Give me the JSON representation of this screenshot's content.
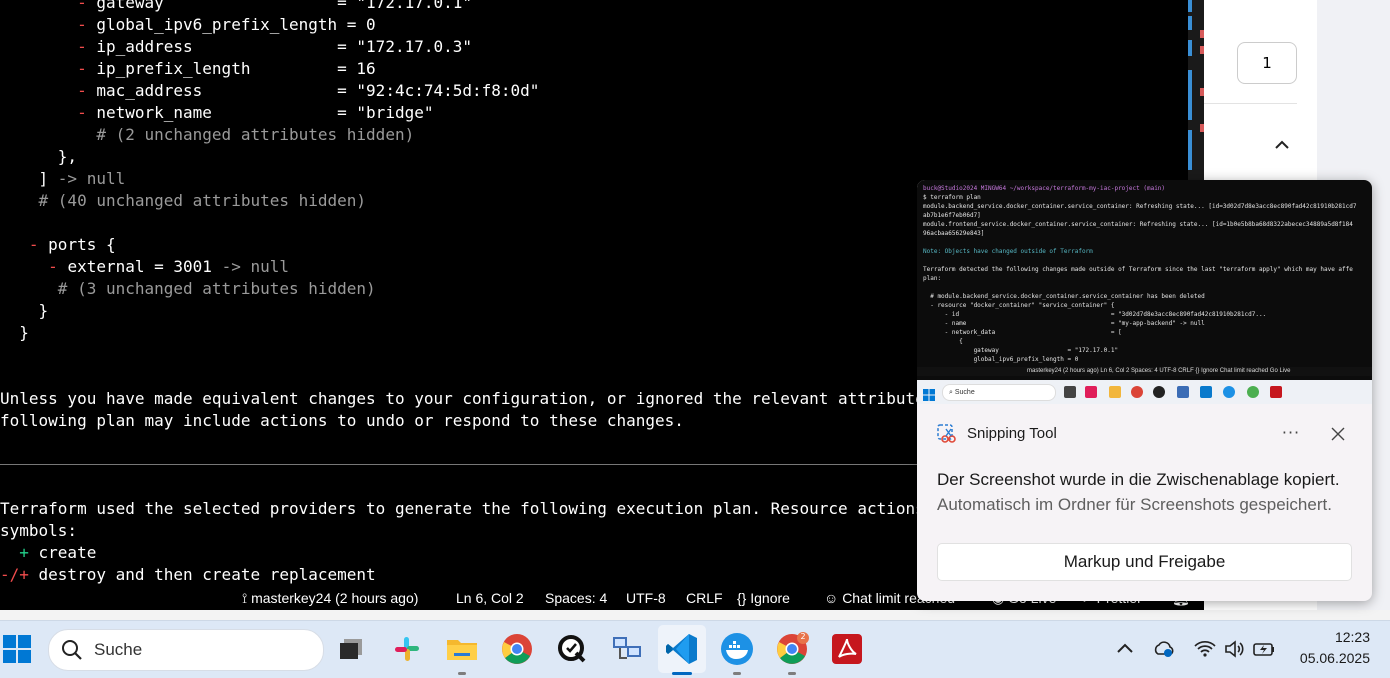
{
  "terminal": {
    "lines": [
      {
        "indent": "        ",
        "prefix": "- ",
        "text": "gateway                  = \"172.17.0.1\"",
        "suffix": ""
      },
      {
        "indent": "        ",
        "prefix": "- ",
        "text": "global_ipv6_prefix_length = 0",
        "suffix": ""
      },
      {
        "indent": "        ",
        "prefix": "- ",
        "text": "ip_address               = \"172.17.0.3\"",
        "suffix": ""
      },
      {
        "indent": "        ",
        "prefix": "- ",
        "text": "ip_prefix_length         = 16",
        "suffix": ""
      },
      {
        "indent": "        ",
        "prefix": "- ",
        "text": "mac_address              = \"92:4c:74:5d:f8:0d\"",
        "suffix": ""
      },
      {
        "indent": "        ",
        "prefix": "- ",
        "text": "network_name             = \"bridge\"",
        "suffix": ""
      },
      {
        "indent": "          ",
        "prefix": "",
        "text": "",
        "suffix": "# (2 unchanged attributes hidden)"
      },
      {
        "indent": "      ",
        "prefix": "",
        "text": "},",
        "suffix": ""
      },
      {
        "indent": "    ",
        "prefix": "",
        "text": "] ",
        "suffix": "-> null"
      },
      {
        "indent": "    ",
        "prefix": "",
        "text": "",
        "suffix": "# (40 unchanged attributes hidden)"
      },
      {
        "indent": "",
        "prefix": "",
        "text": "",
        "suffix": ""
      },
      {
        "indent": "   ",
        "prefix": "- ",
        "text": "ports {",
        "suffix": ""
      },
      {
        "indent": "     ",
        "prefix": "- ",
        "text": "external = 3001 ",
        "suffix": "-> null"
      },
      {
        "indent": "      ",
        "prefix": "",
        "text": "",
        "suffix": "# (3 unchanged attributes hidden)"
      },
      {
        "indent": "    ",
        "prefix": "",
        "text": "}",
        "suffix": ""
      },
      {
        "indent": "  ",
        "prefix": "",
        "text": "}",
        "suffix": ""
      },
      {
        "indent": "",
        "prefix": "",
        "text": "",
        "suffix": ""
      },
      {
        "indent": "",
        "prefix": "",
        "text": "",
        "suffix": ""
      },
      {
        "indent": "",
        "prefix": "",
        "text": "Unless you have made equivalent changes to your configuration, or ignored the relevant attributes usin",
        "suffix": ""
      },
      {
        "indent": "",
        "prefix": "",
        "text": "following plan may include actions to undo or respond to these changes.",
        "suffix": ""
      },
      {
        "indent": "",
        "prefix": "",
        "text": "",
        "suffix": ""
      },
      {
        "indent": "",
        "prefix": "",
        "text": "",
        "suffix": ""
      },
      {
        "indent": "",
        "prefix": "",
        "text": "",
        "suffix": ""
      },
      {
        "indent": "",
        "prefix": "",
        "text": "Terraform used the selected providers to generate the following execution plan. Resource actions are i",
        "suffix": ""
      },
      {
        "indent": "",
        "prefix": "",
        "text": "symbols:",
        "suffix": ""
      },
      {
        "indent": "  ",
        "prefix": "+ ",
        "text": "create",
        "suffix": "",
        "prefixColor": "green"
      },
      {
        "indent": "",
        "prefix": "-/+ ",
        "text": "destroy and then create replacement",
        "suffix": "",
        "prefixColor": "mixed"
      }
    ]
  },
  "right_panel": {
    "page_number": "1"
  },
  "statusbar": {
    "branch": "masterkey24 (2 hours ago)",
    "position": "Ln 6, Col 2",
    "spaces": "Spaces: 4",
    "encoding": "UTF-8",
    "eol": "CRLF",
    "language": "Ignore",
    "chat": "Chat limit reached",
    "golive": "Go Live",
    "prettier": "Prettier"
  },
  "snipping": {
    "app_name": "Snipping Tool",
    "more": "···",
    "message": "Der Screenshot wurde in die Zwischenablage kopiert.",
    "submessage": "Automatisch im Ordner für Screenshots gespeichert.",
    "button": "Markup und Freigabe",
    "preview": {
      "lines": [
        {
          "cls": "p",
          "text": "buck@Studio2024 MINGW64 ~/workspace/terraform-my-iac-project (main)"
        },
        {
          "cls": "",
          "text": "$ terraform plan"
        },
        {
          "cls": "",
          "text": "module.backend_service.docker_container.service_container: Refreshing state... [id=3d02d7d8e3acc8ec890fad42c81910b281cd7"
        },
        {
          "cls": "",
          "text": "ab7b1e6f7eb06d7]"
        },
        {
          "cls": "",
          "text": "module.frontend_service.docker_container.service_container: Refreshing state... [id=1b0e5b8ba68d8322abecec34889a5d8f184"
        },
        {
          "cls": "",
          "text": "96acbaa65629e843]"
        },
        {
          "cls": "",
          "text": ""
        },
        {
          "cls": "c",
          "text": "Note: Objects have changed outside of Terraform"
        },
        {
          "cls": "",
          "text": ""
        },
        {
          "cls": "",
          "text": "Terraform detected the following changes made outside of Terraform since the last \"terraform apply\" which may have affe"
        },
        {
          "cls": "",
          "text": "plan:"
        },
        {
          "cls": "",
          "text": ""
        },
        {
          "cls": "",
          "text": "  # module.backend_service.docker_container.service_container has been deleted"
        },
        {
          "cls": "",
          "text": "  - resource \"docker_container\" \"service_container\" {"
        },
        {
          "cls": "",
          "text": "      - id                                          = \"3d02d7d8e3acc8ec890fad42c81910b281cd7..."
        },
        {
          "cls": "",
          "text": "      - name                                        = \"my-app-backend\" -> null"
        },
        {
          "cls": "",
          "text": "      - network_data                                = ["
        },
        {
          "cls": "",
          "text": "          {"
        },
        {
          "cls": "",
          "text": "              gateway                   = \"172.17.0.1\""
        },
        {
          "cls": "",
          "text": "              global_ipv6_prefix_length = 0"
        }
      ],
      "status": "masterkey24 (2 hours ago)   Ln 6, Col 2   Spaces: 4   UTF-8   CRLF   {} Ignore   Chat limit reached   Go Live",
      "search": "Suche"
    }
  },
  "taskbar": {
    "search_placeholder": "Suche",
    "time": "12:23",
    "date": "05.06.2025",
    "notification_count": "2"
  }
}
